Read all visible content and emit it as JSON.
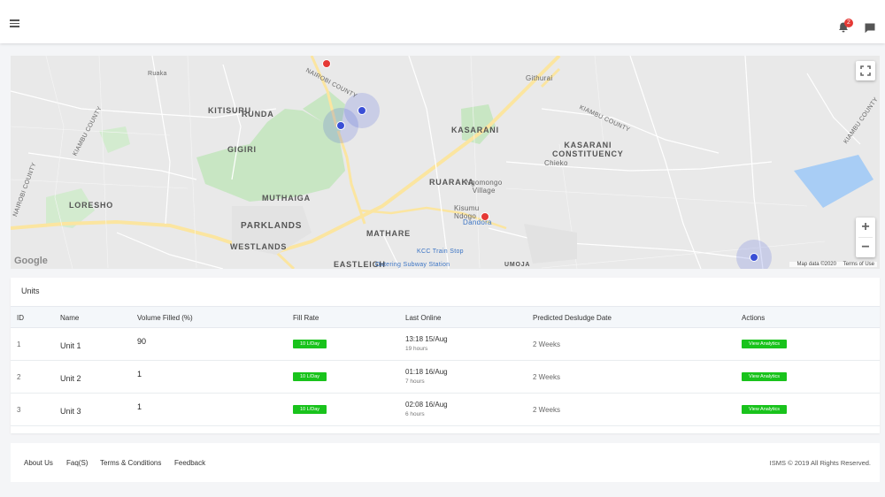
{
  "header": {
    "notification_count": "2"
  },
  "map": {
    "labels": {
      "runda": "RUNDA",
      "kitisuru": "KITISURU",
      "gigiri": "GIGIRI",
      "muthaiga": "MUTHAIGA",
      "parklands": "PARKLANDS",
      "westlands": "WESTLANDS",
      "loresho": "LORESHO",
      "mathare": "MATHARE",
      "eastleigh": "EASTLEIGH",
      "ruaraka": "RUARAKA",
      "kasarani": "KASARANI",
      "kasarani_constituency": "KASARANI\nCONSTITUENCY",
      "githurai": "Githurai",
      "chieko": "Chieko",
      "ngomongo": "Ngomongo\nVillage",
      "kisumu": "Kisumu\nNdogo",
      "dandora": "Dandora",
      "kcc": "KCC Train Stop",
      "outering": "Outering Subway Station",
      "umoja": "UMOJA",
      "kiambu1": "KIAMBU COUNTY",
      "kiambu2": "KIAMBU COUNTY",
      "kiambu3": "KIAMBU COUNTY",
      "nairobi1": "NAIROBI COUNTY",
      "nairobi2": "NAIROBI COUNTY",
      "ruaka": "Ruaka"
    },
    "google": "Google",
    "map_data": "Map data ©2020",
    "terms": "Terms of Use",
    "zoom_in": "+",
    "zoom_out": "−",
    "colors": {
      "marker_red": "#e53935",
      "marker_blue": "#3a4fd6",
      "park_green": "#c5e6c0",
      "road_yellow": "#fbe29a"
    }
  },
  "units": {
    "title": "Units",
    "columns": [
      "ID",
      "Name",
      "Volume Filled (%)",
      "Fill Rate",
      "Last Online",
      "Predicted Desludge Date",
      "Actions"
    ],
    "rows": [
      {
        "id": "1",
        "name": "Unit 1",
        "volume": "90",
        "fill_rate": "10 L/Day",
        "last_online": "13:18 15/Aug",
        "ago": "19 hours",
        "desludge": "2 Weeks",
        "action": "View Analytics"
      },
      {
        "id": "2",
        "name": "Unit 2",
        "volume": "1",
        "fill_rate": "10 L/Day",
        "last_online": "01:18 16/Aug",
        "ago": "7 hours",
        "desludge": "2 Weeks",
        "action": "View Analytics"
      },
      {
        "id": "3",
        "name": "Unit 3",
        "volume": "1",
        "fill_rate": "10 L/Day",
        "last_online": "02:08 16/Aug",
        "ago": "6 hours",
        "desludge": "2 Weeks",
        "action": "View Analytics"
      }
    ]
  },
  "footer": {
    "links": [
      "About Us",
      "Faq(S)",
      "Terms & Conditions",
      "Feedback"
    ],
    "copyright": "ISMS © 2019 All Rights Reserved."
  }
}
